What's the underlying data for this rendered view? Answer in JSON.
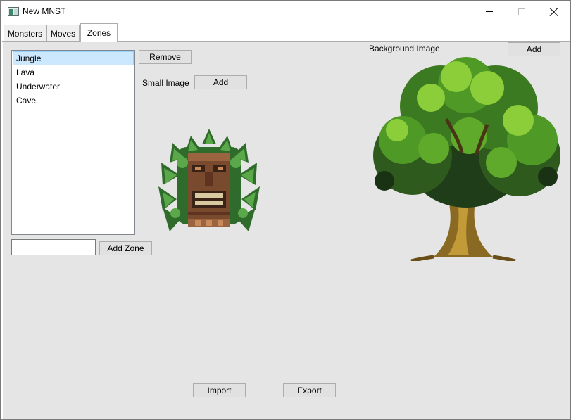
{
  "window": {
    "title": "New MNST",
    "icon": "app-window-icon"
  },
  "tabs": [
    {
      "label": "Monsters",
      "active": false
    },
    {
      "label": "Moves",
      "active": false
    },
    {
      "label": "Zones",
      "active": true
    }
  ],
  "zones": {
    "items": [
      "Jungle",
      "Lava",
      "Underwater",
      "Cave"
    ],
    "selected": "Jungle",
    "remove_label": "Remove",
    "new_zone_value": "",
    "add_zone_label": "Add Zone"
  },
  "small_image": {
    "label": "Small Image",
    "add_label": "Add",
    "image": "tiki-mask-sprite"
  },
  "background_image": {
    "label": "Background Image",
    "add_label": "Add",
    "image": "tree-sprite"
  },
  "footer": {
    "import_label": "Import",
    "export_label": "Export"
  },
  "colors": {
    "selection": "#cce8ff",
    "panel": "#e5e5e5",
    "button": "#e1e1e1"
  }
}
